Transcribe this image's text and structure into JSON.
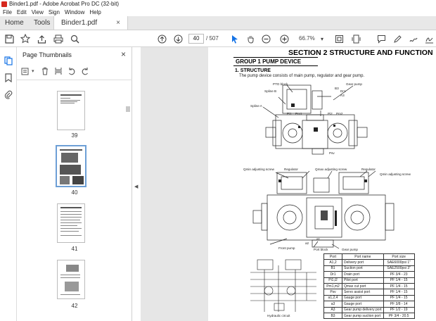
{
  "window": {
    "title": "Binder1.pdf - Adobe Acrobat Pro DC (32-bit)"
  },
  "menu": [
    "File",
    "Edit",
    "View",
    "Sign",
    "Window",
    "Help"
  ],
  "tabs": {
    "home": "Home",
    "tools": "Tools",
    "document": "Binder1.pdf",
    "close": "×"
  },
  "toolbar": {
    "current_page": "40",
    "page_total": "/ 507",
    "zoom": "66.7%",
    "zoom_caret": "▾"
  },
  "thumbnails_panel": {
    "title": "Page Thumbnails",
    "close": "×",
    "options_caret": "▾",
    "pages": [
      "39",
      "40",
      "41",
      "42"
    ],
    "selected": "40"
  },
  "document": {
    "section_title": "SECTION 2  STRUCTURE AND FUNCTION",
    "group_title": "GROUP 1  PUMP DEVICE",
    "heading": "1. STRUCTURE",
    "description": "The pump device consists of main pump, regulator and gear pump.",
    "labels": {
      "pto_block": "PTO block",
      "gear_pump": "Gear pump",
      "spline_b": "Spline B",
      "spline_a": "Spline A",
      "qmin_left": "Qmin adjusting screw",
      "regulator_left": "Regulator",
      "qmax": "Qmax adjusting screw",
      "regulator_right": "Regulator",
      "qmin_right": "Qmin adjusting screw",
      "front_pump": "Front pump",
      "port_block": "Port block",
      "gear_pump_bottom": "Gear pump",
      "hydraulic_circuit": "Hydraulic circuit",
      "dr1": "Dr1",
      "a3": "A3",
      "b3": "B3",
      "pi1": "Pi1",
      "pm1": "Pm1",
      "pi2": "Pi2",
      "pm2": "Pm2",
      "psv": "Psv",
      "a1": "A1",
      "a2": "A2",
      "b1": "B1",
      "a1_small": "a1",
      "a2_small": "a2"
    },
    "port_table": {
      "headers": [
        "Port",
        "Port name",
        "Port size"
      ],
      "rows": [
        [
          "A1,2",
          "Delivery port",
          "SAE6000psi 1\""
        ],
        [
          "B1",
          "Suction port",
          "SAE2500psi 3\""
        ],
        [
          "Dr1",
          "Drain port",
          "PF 3/4 - 23"
        ],
        [
          "Pi1,i2",
          "Pilot port",
          "PF 1/4 - 15"
        ],
        [
          "Pm1,m2",
          "Qmax cut port",
          "PF 1/4 - 15"
        ],
        [
          "Psv",
          "Servo assist port",
          "PF 1/4 - 15"
        ],
        [
          "a1,2,4",
          "Gauge port",
          "PF 1/4 - 15"
        ],
        [
          "a3",
          "Gauge port",
          "PF 3/8 - 14"
        ],
        [
          "A3",
          "Gear pump delivery port",
          "PF 1/2 - 19"
        ],
        [
          "B3",
          "Gear pump suction port",
          "PF 3/4 - 20.5"
        ]
      ]
    }
  },
  "colors": {
    "accent": "#1473e6",
    "app_icon": "#d6281e",
    "selection": "#6d9fd6"
  }
}
